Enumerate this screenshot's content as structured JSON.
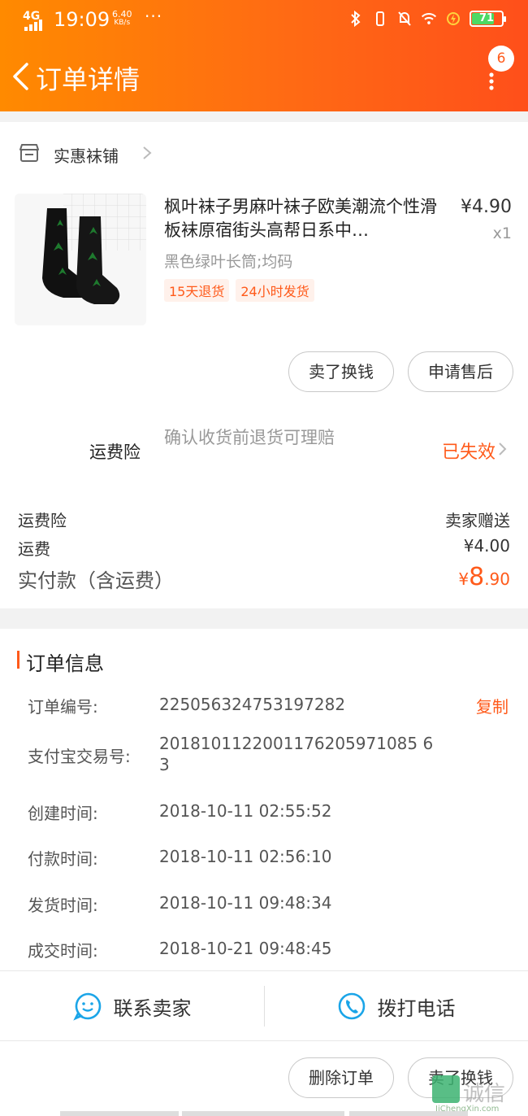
{
  "status_bar": {
    "network": "4G",
    "time": "19:09",
    "speed_value": "6.40",
    "speed_unit": "KB/s",
    "more": "···",
    "battery": "71"
  },
  "header": {
    "title": "订单详情",
    "badge_count": "6"
  },
  "shop": {
    "name": "实惠袜铺"
  },
  "product": {
    "title": "枫叶袜子男麻叶袜子欧美潮流个性滑板袜原宿街头高帮日系中…",
    "price": "¥4.90",
    "qty": "x1",
    "sku": "黑色绿叶长筒;均码",
    "tags": [
      "15天退货",
      "24小时发货"
    ]
  },
  "item_actions": {
    "sell_label": "卖了换钱",
    "after_sale_label": "申请售后"
  },
  "insurance": {
    "label": "运费险",
    "desc": "确认收货前退货可理赔",
    "status": "已失效"
  },
  "summary": {
    "insurance_label": "运费险",
    "insurance_value": "卖家赠送",
    "shipping_label": "运费",
    "shipping_value": "¥4.00",
    "total_label": "实付款（含运费）",
    "total_currency": "¥",
    "total_int": "8",
    "total_dec": ".90"
  },
  "order_info": {
    "title": "订单信息",
    "copy_label": "复制",
    "rows": [
      {
        "key": "订单编号:",
        "value": "225056324753197282"
      },
      {
        "key": "支付宝交易号:",
        "value": "2018101122001176205971085 63"
      },
      {
        "key": "创建时间:",
        "value": "2018-10-11 02:55:52"
      },
      {
        "key": "付款时间:",
        "value": "2018-10-11 02:56:10"
      },
      {
        "key": "发货时间:",
        "value": "2018-10-11 09:48:34"
      },
      {
        "key": "成交时间:",
        "value": "2018-10-21 09:48:45"
      }
    ]
  },
  "contact": {
    "seller_label": "联系卖家",
    "call_label": "拨打电话"
  },
  "footer_actions": {
    "delete_label": "删除订单",
    "sell_label": "卖了换钱"
  },
  "watermark": {
    "text": "诚信",
    "en": "JiChengXin.com"
  },
  "colors": {
    "accent": "#ff5a1a",
    "header_start": "#ff8a00",
    "header_end": "#ff4f1a",
    "icon_blue": "#1ba5e8"
  }
}
